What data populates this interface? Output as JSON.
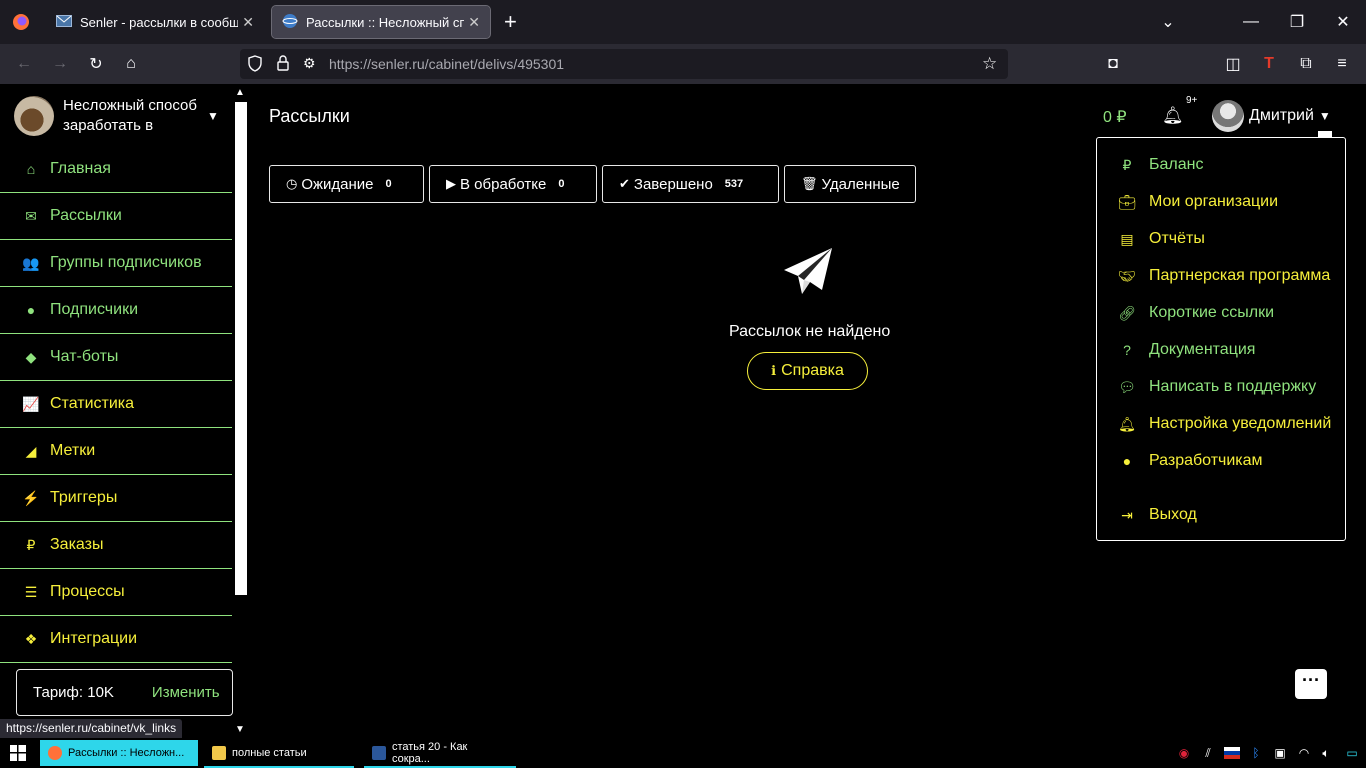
{
  "browser": {
    "tabs": [
      {
        "title": "Senler - рассылки в сообщест",
        "active": false
      },
      {
        "title": "Рассылки :: Несложный спосо",
        "active": true
      }
    ],
    "url_host": "https://senler.ru",
    "url_path": "/cabinet/delivs/495301",
    "status_url": "https://senler.ru/cabinet/vk_links"
  },
  "sidebar": {
    "org_name": "Несложный способ заработать в",
    "items": [
      {
        "label": "Главная",
        "icon": "home-icon",
        "color": "green"
      },
      {
        "label": "Рассылки",
        "icon": "envelope-icon",
        "color": "green"
      },
      {
        "label": "Группы подписчиков",
        "icon": "users-icon",
        "color": "green"
      },
      {
        "label": "Подписчики",
        "icon": "user-icon",
        "color": "green"
      },
      {
        "label": "Чат-боты",
        "icon": "android-icon",
        "color": "green"
      },
      {
        "label": "Статистика",
        "icon": "chart-icon",
        "color": "yellow"
      },
      {
        "label": "Метки",
        "icon": "tag-icon",
        "color": "yellow"
      },
      {
        "label": "Триггеры",
        "icon": "bolt-icon",
        "color": "yellow"
      },
      {
        "label": "Заказы",
        "icon": "ruble-icon",
        "color": "yellow"
      },
      {
        "label": "Процессы",
        "icon": "tasks-icon",
        "color": "yellow"
      },
      {
        "label": "Интеграции",
        "icon": "cubes-icon",
        "color": "yellow"
      }
    ],
    "tariff_label": "Тариф: 10K",
    "tariff_change": "Изменить"
  },
  "header": {
    "title": "Рассылки",
    "balance": "0 ₽",
    "notif_badge": "9+",
    "user_name": "Дмитрий"
  },
  "status_tabs": [
    {
      "label": "Ожидание",
      "count": "0",
      "icon": "clock-icon"
    },
    {
      "label": "В обработке",
      "count": "0",
      "icon": "play-icon"
    },
    {
      "label": "Завершено",
      "count": "537",
      "icon": "check-icon"
    },
    {
      "label": "Удаленные",
      "count": "",
      "icon": "trash-icon"
    }
  ],
  "empty": {
    "message": "Рассылок не найдено",
    "help_label": "Справка"
  },
  "dropdown": [
    {
      "label": "Баланс",
      "icon": "ruble-icon",
      "color": "green"
    },
    {
      "label": "Мои организации",
      "icon": "briefcase-icon",
      "color": "yellow"
    },
    {
      "label": "Отчёты",
      "icon": "file-icon",
      "color": "yellow"
    },
    {
      "label": "Партнерская программа",
      "icon": "handshake-icon",
      "color": "yellow"
    },
    {
      "label": "Короткие ссылки",
      "icon": "link-icon",
      "color": "green"
    },
    {
      "label": "Документация",
      "icon": "question-icon",
      "color": "green"
    },
    {
      "label": "Написать в поддержку",
      "icon": "comment-icon",
      "color": "green"
    },
    {
      "label": "Настройка уведомлений",
      "icon": "bell-icon",
      "color": "yellow"
    },
    {
      "label": "Разработчикам",
      "icon": "github-icon",
      "color": "yellow"
    },
    {
      "label": "Выход",
      "icon": "sign-out-icon",
      "color": "yellow"
    }
  ],
  "taskbar": [
    {
      "label": "Рассылки :: Несложн...",
      "active": true
    },
    {
      "label": "полные статьи",
      "active": false
    },
    {
      "label": "статья 20 - Как сокра...",
      "active": false
    }
  ],
  "colors": {
    "green": "#8fe27e",
    "yellow": "#f6ef3b",
    "accent_taskbar": "#2ed6ea"
  }
}
